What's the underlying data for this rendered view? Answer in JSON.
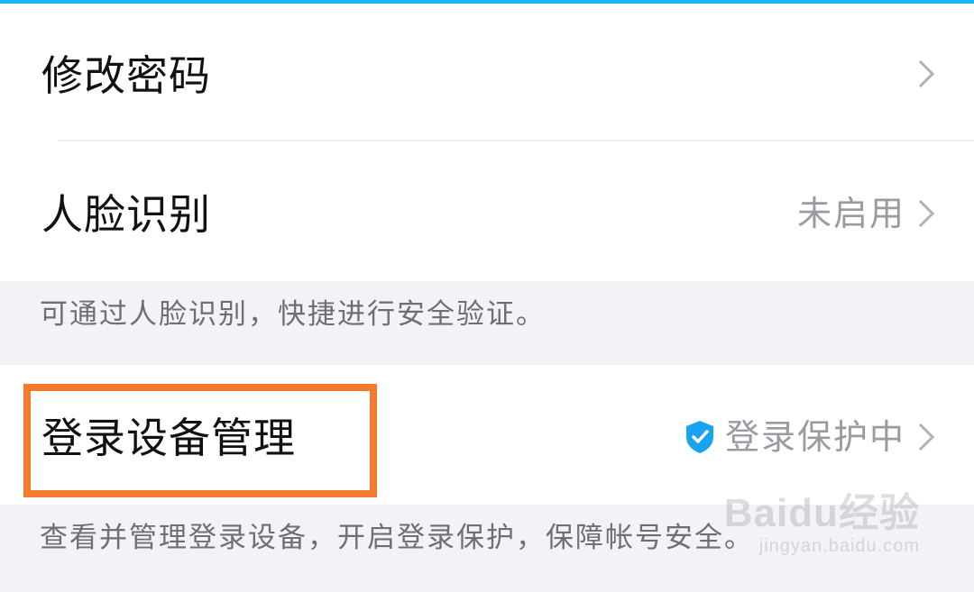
{
  "settings": {
    "change_password": {
      "label": "修改密码"
    },
    "face_recognition": {
      "label": "人脸识别",
      "status": "未启用",
      "hint": "可通过人脸识别，快捷进行安全验证。"
    },
    "device_management": {
      "label": "登录设备管理",
      "status": "登录保护中",
      "status_icon": "shield-check-icon",
      "hint": "查看并管理登录设备，开启登录保护，保障帐号安全。"
    }
  },
  "annotation": {
    "highlight_color": "#f47a2e"
  },
  "watermark": {
    "main": "Baidu经验",
    "sub": "jingyan.baidu.com"
  },
  "colors": {
    "accent": "#12b7f5",
    "shield": "#1aa3f2",
    "secondary_text": "#9a9aa0"
  }
}
